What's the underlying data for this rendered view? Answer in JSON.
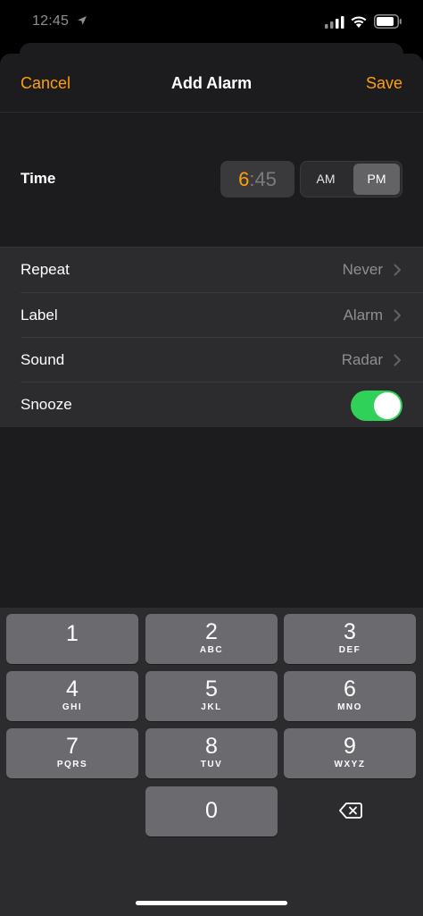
{
  "status_bar": {
    "time": "12:45"
  },
  "nav": {
    "cancel": "Cancel",
    "title": "Add Alarm",
    "save": "Save"
  },
  "time": {
    "label": "Time",
    "hour": "6",
    "separator_minutes": ":45",
    "am": "AM",
    "pm": "PM",
    "selected_period": "PM"
  },
  "settings": {
    "repeat": {
      "label": "Repeat",
      "value": "Never"
    },
    "label": {
      "label": "Label",
      "value": "Alarm"
    },
    "sound": {
      "label": "Sound",
      "value": "Radar"
    },
    "snooze": {
      "label": "Snooze",
      "on": true
    }
  },
  "keypad": {
    "keys": [
      {
        "num": "1",
        "letters": ""
      },
      {
        "num": "2",
        "letters": "ABC"
      },
      {
        "num": "3",
        "letters": "DEF"
      },
      {
        "num": "4",
        "letters": "GHI"
      },
      {
        "num": "5",
        "letters": "JKL"
      },
      {
        "num": "6",
        "letters": "MNO"
      },
      {
        "num": "7",
        "letters": "PQRS"
      },
      {
        "num": "8",
        "letters": "TUV"
      },
      {
        "num": "9",
        "letters": "WXYZ"
      },
      {
        "num": "0",
        "letters": ""
      }
    ]
  },
  "colors": {
    "accent": "#ff9f0a",
    "toggle_on": "#30d158"
  }
}
